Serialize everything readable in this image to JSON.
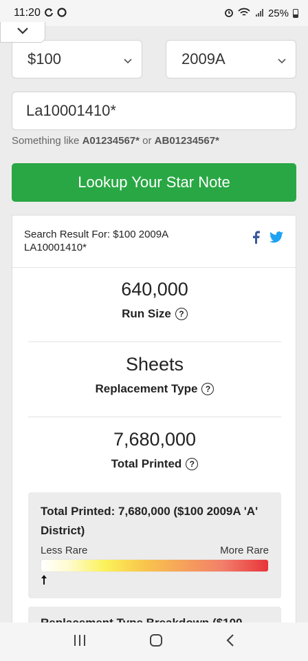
{
  "status_bar": {
    "time": "11:20",
    "battery": "25%"
  },
  "form": {
    "denomination": "$100",
    "series": "2009A",
    "serial_value": "La10001410*",
    "hint_prefix": "Something like",
    "hint_example_1": "A01234567*",
    "hint_or": "or",
    "hint_example_2": "AB01234567*",
    "lookup_button": "Lookup Your Star Note"
  },
  "result": {
    "header": "Search Result For: $100 2009A LA10001410*",
    "run_size_value": "640,000",
    "run_size_label": "Run Size",
    "replacement_value": "Sheets",
    "replacement_label": "Replacement Type",
    "total_printed_value": "7,680,000",
    "total_printed_label": "Total Printed",
    "rarity_title": "Total Printed: 7,680,000 ($100 2009A 'A' District)",
    "less_rare": "Less Rare",
    "more_rare": "More Rare",
    "indicator_arrow": "🠕",
    "breakdown_title": "Replacement Type Breakdown ($100"
  },
  "icons": {
    "question": "?"
  },
  "colors": {
    "lookup_button": "#29a744",
    "facebook": "#3b5998",
    "twitter": "#1da1f2"
  }
}
